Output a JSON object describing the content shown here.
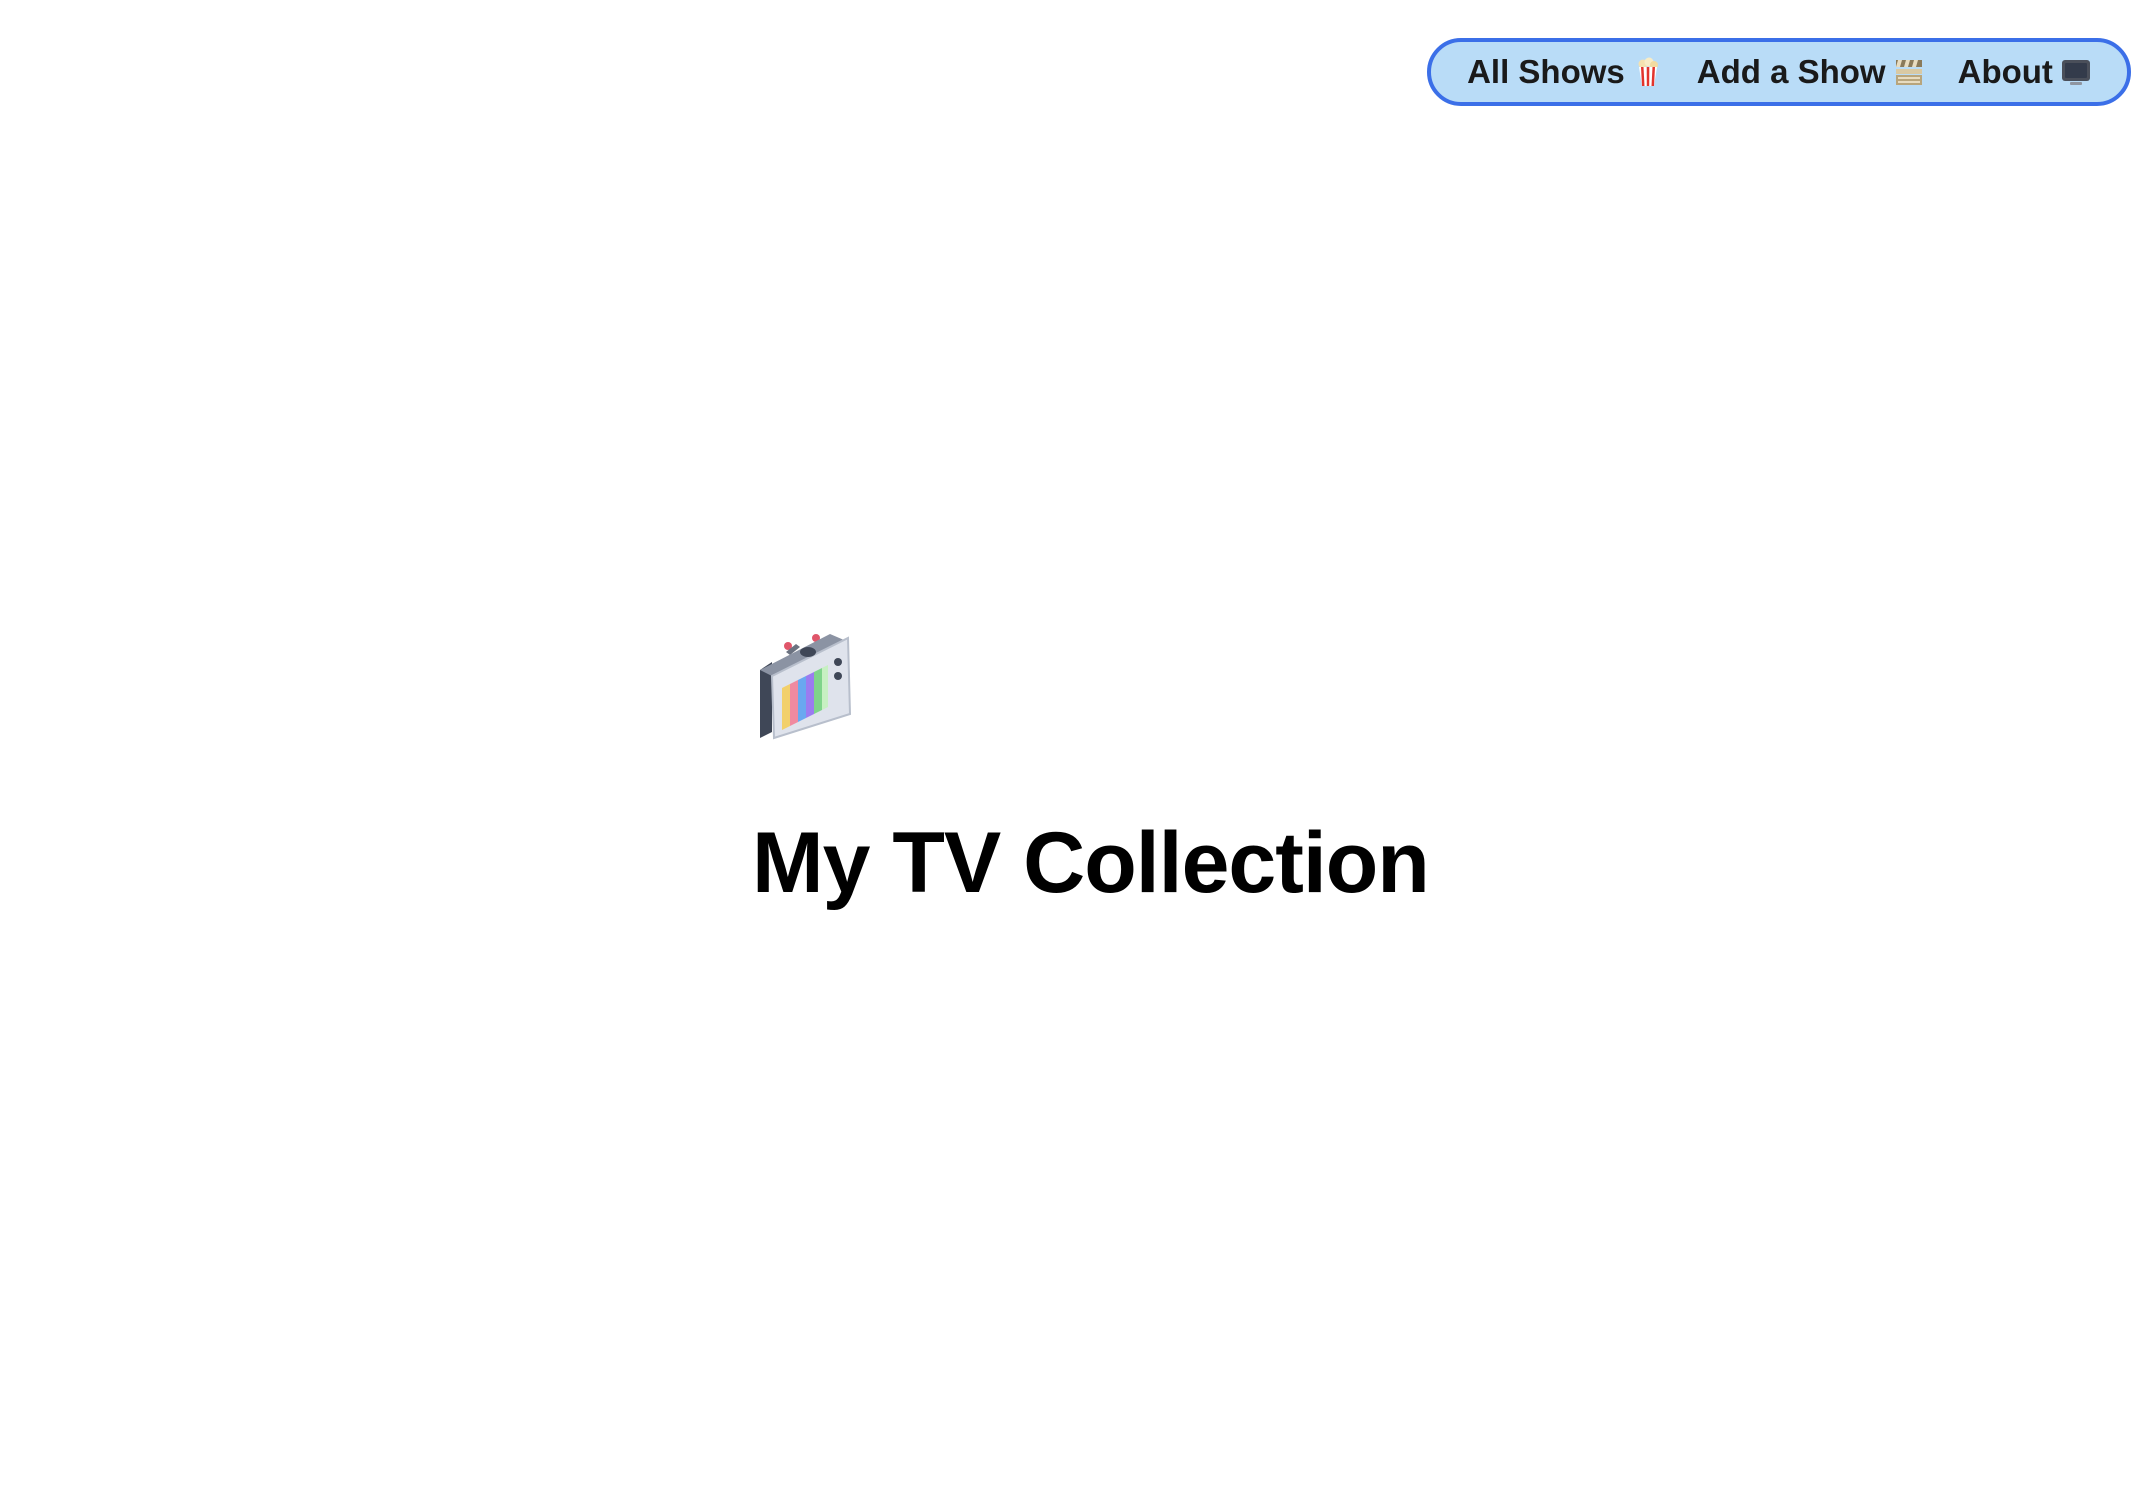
{
  "nav": {
    "items": [
      {
        "label": "All Shows",
        "icon": "popcorn-icon"
      },
      {
        "label": "Add a Show",
        "icon": "clapperboard-icon"
      },
      {
        "label": "About",
        "icon": "television-icon"
      }
    ]
  },
  "hero": {
    "logo_icon": "retro-tv-icon",
    "title": "My TV Collection"
  },
  "colors": {
    "nav_background": "#b9dcf7",
    "nav_border": "#3b6fe8",
    "title_text": "#000000"
  }
}
